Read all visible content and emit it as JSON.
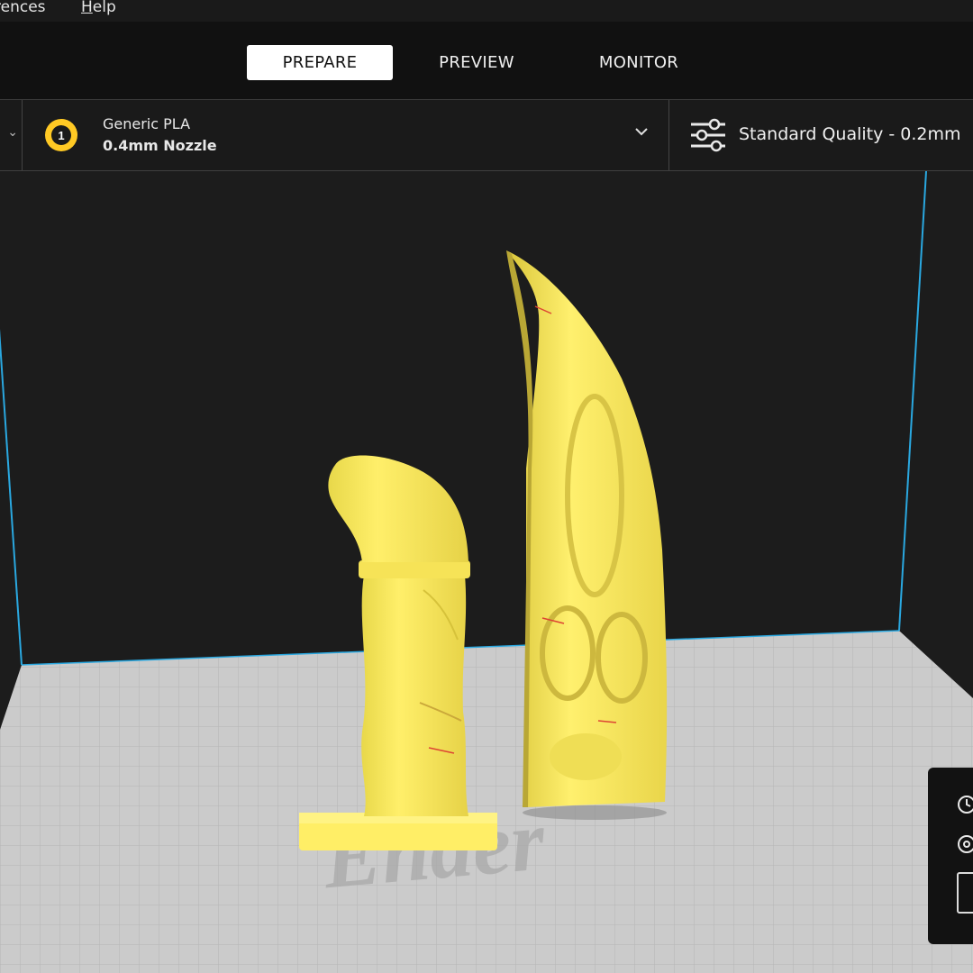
{
  "menu": {
    "preferences_partial": "rences",
    "help_mnemonic": "H",
    "help_rest": "elp"
  },
  "stages": {
    "prepare": "PREPARE",
    "preview": "PREVIEW",
    "monitor": "MONITOR",
    "active": "prepare"
  },
  "material": {
    "extruder_number": "1",
    "name": "Generic PLA",
    "nozzle": "0.4mm Nozzle",
    "badge_color": "#ffc924"
  },
  "quality": {
    "label": "Standard Quality - 0.2mm"
  },
  "viewport": {
    "build_plate_logo_text": "Ender",
    "model_color": "#ffee66",
    "plate_color": "#c8c8c8",
    "volume_edge_color": "#2aa8e0"
  }
}
